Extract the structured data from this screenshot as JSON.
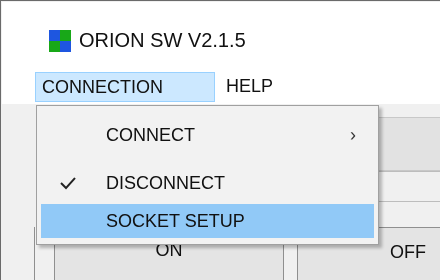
{
  "window": {
    "title": "ORION SW V2.1.5"
  },
  "menubar": {
    "items": [
      {
        "label": "CONNECTION",
        "active": true
      },
      {
        "label": "HELP",
        "active": false
      }
    ]
  },
  "dropdown": {
    "items": [
      {
        "label": "CONNECT",
        "checked": false,
        "has_submenu": true,
        "submenu_glyph": "›"
      },
      {
        "label": "DISCONNECT",
        "checked": true,
        "has_submenu": false
      },
      {
        "label": "SOCKET SETUP",
        "checked": false,
        "has_submenu": false,
        "highlighted": true
      }
    ]
  },
  "buttons": {
    "on_label": "ON",
    "off_label": "OFF"
  },
  "colors": {
    "menu_active_bg": "#cce8ff",
    "menu_highlight_bg": "#91c9f7",
    "logo_blue": "#1e56e0",
    "logo_green": "#18a818"
  }
}
